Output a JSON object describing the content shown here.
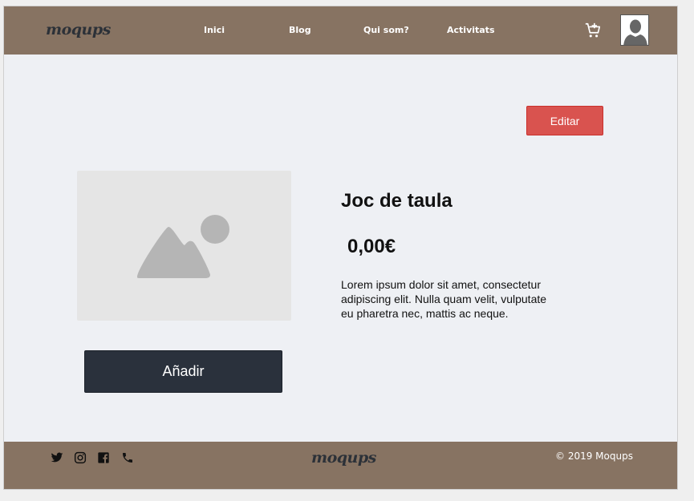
{
  "header": {
    "logo": "moqups",
    "nav": [
      "Inici",
      "Blog",
      "Qui som?",
      "Activitats"
    ],
    "cart_icon": "cart-add-icon",
    "avatar_icon": "user-avatar-icon"
  },
  "toolbar": {
    "edit_label": "Editar"
  },
  "product": {
    "image_icon": "image-placeholder-icon",
    "title": "Joc de taula",
    "price": "0,00€",
    "description": "Lorem ipsum dolor sit amet, consectetur adipiscing elit. Nulla quam velit, vulputate eu pharetra nec, mattis ac neque.",
    "add_label": "Añadir"
  },
  "footer": {
    "social_icons": [
      "twitter-icon",
      "instagram-icon",
      "facebook-icon",
      "phone-icon"
    ],
    "logo": "moqups",
    "copyright": "© 2019  Moqups"
  },
  "colors": {
    "header_bg": "#877362",
    "page_bg": "#eef0f4",
    "edit_button": "#d9534f",
    "add_button": "#2a313c"
  }
}
